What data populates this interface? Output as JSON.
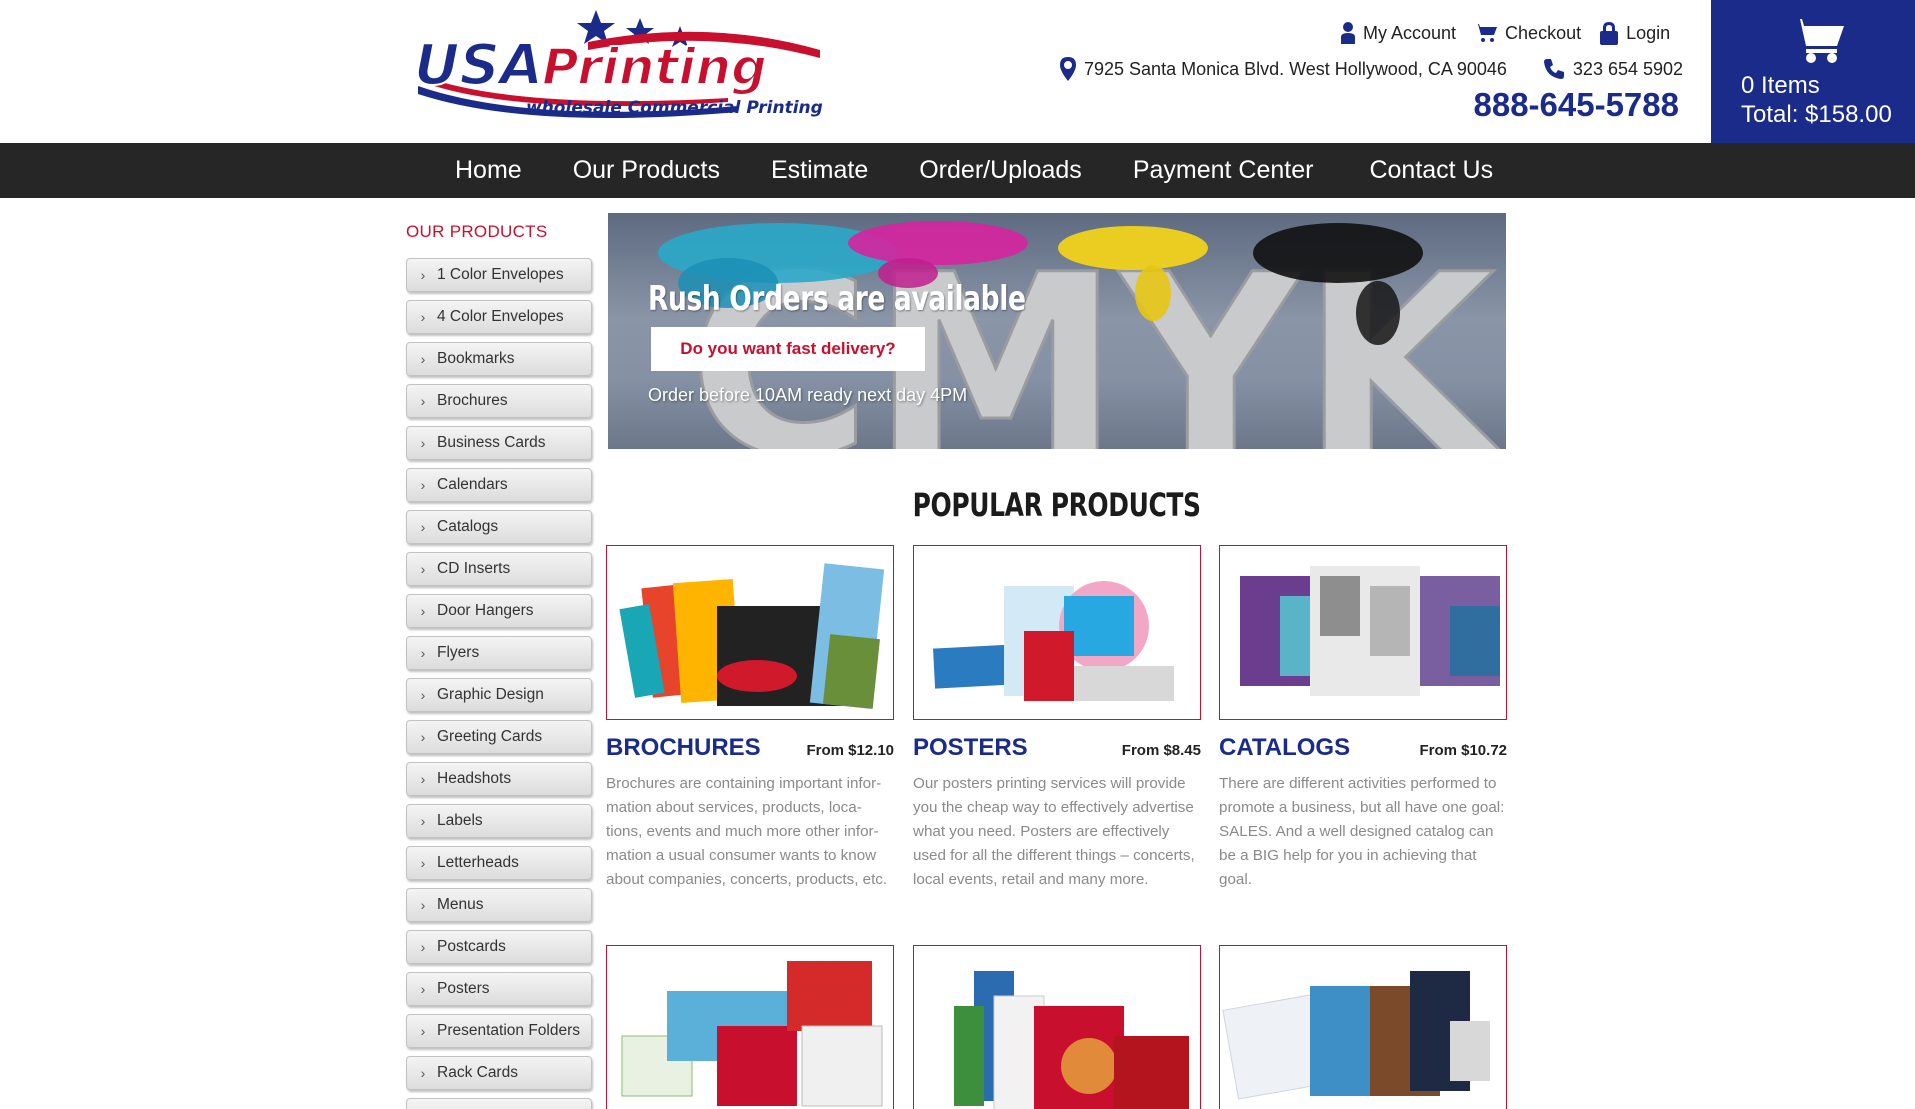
{
  "header": {
    "logo_text": "USA Printing",
    "logo_tagline": "wholesale Commercial Printing",
    "links": [
      {
        "label": "My Account",
        "icon": "user-icon"
      },
      {
        "label": "Checkout",
        "icon": "cart-icon"
      },
      {
        "label": "Login",
        "icon": "lock-icon"
      }
    ],
    "address": "7925 Santa Monica Blvd. West Hollywood, CA 90046",
    "phone_local": "323 654 5902",
    "phone_main": "888-645-5788"
  },
  "cart": {
    "items": "0 Items",
    "total": "Total: $158.00"
  },
  "nav": {
    "items": [
      "Home",
      "Our Products",
      "Estimate",
      "Order/Uploads",
      "Payment Center",
      "Contact Us"
    ]
  },
  "sidebar": {
    "title": "OUR PRODUCTS",
    "items": [
      "1 Color Envelopes",
      "4 Color Envelopes",
      "Bookmarks",
      "Brochures",
      "Business Cards",
      "Calendars",
      "Catalogs",
      "CD Inserts",
      "Door Hangers",
      "Flyers",
      "Graphic Design",
      "Greeting Cards",
      "Headshots",
      "Labels",
      "Letterheads",
      "Menus",
      "Postcards",
      "Posters",
      "Presentation Folders",
      "Rack Cards"
    ]
  },
  "banner": {
    "title": "Rush Orders are available",
    "button_label": "Do you want fast delivery?",
    "subtitle": "Order before 10AM ready next day 4PM",
    "art_text": "CMYK"
  },
  "popular": {
    "title": "POPULAR PRODUCTS",
    "products": [
      {
        "name": "BROCHURES",
        "price": "From $12.10",
        "desc": "Brochures are containing important infor-mation about services, products, loca-tions, events and much more other infor-mation a usual consumer wants to know about companies, concerts, products, etc."
      },
      {
        "name": "POSTERS",
        "price": "From $8.45",
        "desc": "Our posters printing services will provide you the cheap way to effectively advertise what you need. Posters are effectively used for all the different things – concerts, local events, retail and many more."
      },
      {
        "name": "CATALOGS",
        "price": "From $10.72",
        "desc": "There are different activities performed to promote a business, but all have one goal: SALES. And a well designed catalog can be a BIG help for you in achieving that goal."
      }
    ]
  },
  "colors": {
    "brand_blue": "#1a2b8a",
    "brand_red": "#c8102e",
    "nav_bg": "#262626"
  }
}
